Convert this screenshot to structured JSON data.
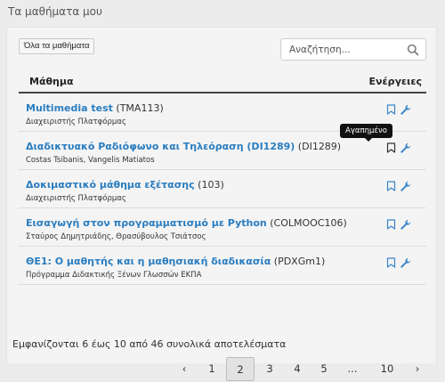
{
  "page_title": "Τα μαθήματα μου",
  "toolbar": {
    "all_courses_label": "Όλα τα μαθήματα",
    "search_placeholder": "Αναζήτηση..."
  },
  "table": {
    "headers": {
      "course": "Μάθημα",
      "actions": "Ενέργειες"
    },
    "rows": [
      {
        "title": "Multimedia test",
        "code": " (TMA113)",
        "sub": "Διαχειριστής Πλατφόρμας"
      },
      {
        "title": "Διαδικτυακό Ραδιόφωνο και Τηλεόραση (DI1289)",
        "code": " (DI1289)",
        "sub": "Costas Tsibanis, Vangelis Matiatos"
      },
      {
        "title": "Δοκιμαστικό μάθημα εξέτασης",
        "code": " (103)",
        "sub": "Διαχειριστής Πλατφόρμας"
      },
      {
        "title": "Εισαγωγή στον προγραμματισμό με Python",
        "code": " (COLMOOC106)",
        "sub": "Σταύρος Δημητριάδης, Θρασύβουλος Τσιάτσος"
      },
      {
        "title": "ΘΕ1: Ο μαθητής και η μαθησιακή διαδικασία",
        "code": " (PDXGm1)",
        "sub": "Πρόγραμμα Διδακτικής Ξένων Γλωσσών ΕΚΠΑ"
      }
    ]
  },
  "tooltip": "Αγαπημένο",
  "summary": "Εμφανίζονται 6 έως 10 από 46 συνολικά αποτελέσματα",
  "pagination": {
    "prev": "‹",
    "pages": [
      "1",
      "2",
      "3",
      "4",
      "5",
      "...",
      "10"
    ],
    "next": "›",
    "current": "2"
  },
  "colors": {
    "link": "#2a7dc0",
    "background": "#ececec",
    "panel": "#f4f4f4"
  },
  "icons": {
    "search": "search-icon",
    "bookmark": "bookmark-icon",
    "wrench": "wrench-icon"
  }
}
